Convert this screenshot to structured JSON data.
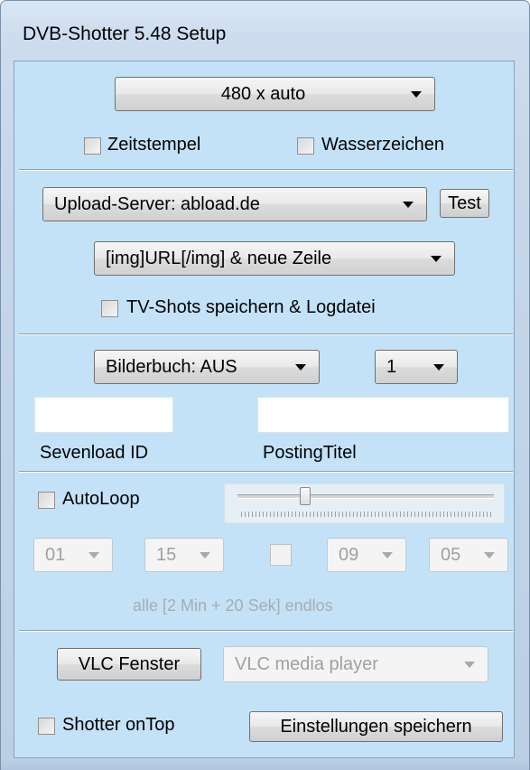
{
  "window": {
    "title": "DVB-Shotter 5.48 Setup"
  },
  "resolution": {
    "selected": "480 x auto"
  },
  "options": {
    "timestamp_label": "Zeitstempel",
    "watermark_label": "Wasserzeichen"
  },
  "upload": {
    "server_selected": "Upload-Server: abload.de",
    "test_label": "Test",
    "format_selected": "[img]URL[/img] & neue Zeile",
    "save_shots_label": "TV-Shots speichern & Logdatei"
  },
  "bilderbuch": {
    "mode_selected": "Bilderbuch: AUS",
    "count_selected": "1",
    "sevenload_label": "Sevenload ID",
    "sevenload_value": "",
    "posting_title_label": "PostingTitel",
    "posting_title_value": ""
  },
  "autoloop": {
    "label": "AutoLoop",
    "slider_fraction": 0.25,
    "field1": "01",
    "field2": "15",
    "field3": "09",
    "field4": "05",
    "status_text": "alle [2 Min + 20 Sek] endlos"
  },
  "vlc": {
    "button_label": "VLC Fenster",
    "window_selected": "VLC media player"
  },
  "footer": {
    "on_top_label": "Shotter onTop",
    "save_settings_label": "Einstellungen speichern"
  }
}
